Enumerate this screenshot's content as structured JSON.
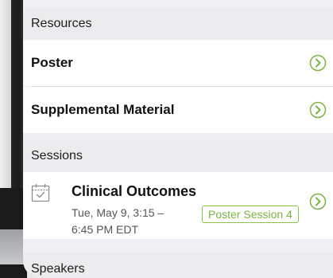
{
  "sections": {
    "resources": "Resources",
    "sessions": "Sessions",
    "speakers": "Speakers"
  },
  "resources": {
    "items": [
      {
        "label": "Poster"
      },
      {
        "label": "Supplemental Material"
      }
    ]
  },
  "session": {
    "title": "Clinical Outcomes",
    "time_line1": "Tue, May 9, 3:15 –",
    "time_line2": "6:45 PM EDT",
    "badge": "Poster Session 4"
  },
  "colors": {
    "accent_green": "#8bc34a",
    "chevron_green": "#7cb342"
  }
}
